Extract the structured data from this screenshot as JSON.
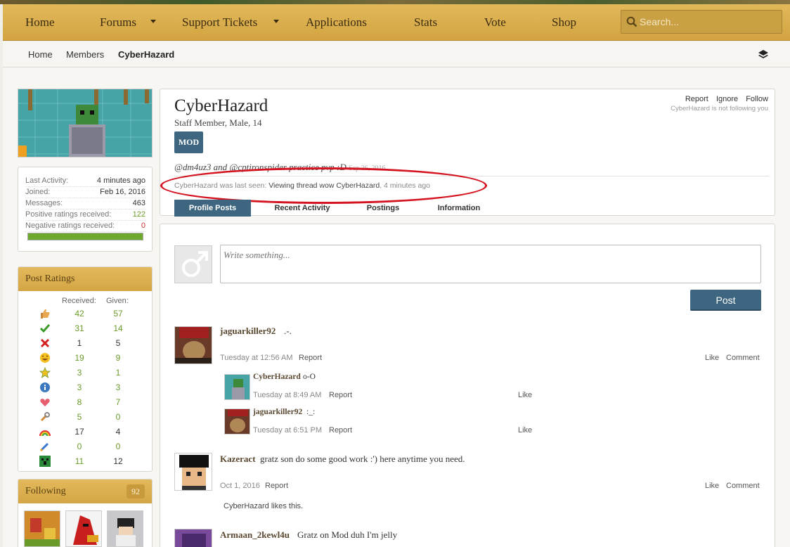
{
  "nav": {
    "items": [
      "Home",
      "Forums",
      "Support Tickets",
      "Applications",
      "Stats",
      "Vote",
      "Shop"
    ],
    "search_placeholder": "Search..."
  },
  "breadcrumb": [
    "Home",
    "Members",
    "CyberHazard"
  ],
  "sidebar": {
    "stats": [
      {
        "label": "Last Activity:",
        "value": "4 minutes ago"
      },
      {
        "label": "Joined:",
        "value": "Feb 16, 2016"
      },
      {
        "label": "Messages:",
        "value": "463"
      },
      {
        "label": "Positive ratings received:",
        "value": "122"
      },
      {
        "label": "Negative ratings received:",
        "value": "0"
      }
    ],
    "positive_ratio": 1.0,
    "post_ratings": {
      "title": "Post Ratings",
      "col_received": "Received:",
      "col_given": "Given:",
      "rows": [
        {
          "icon": "thumbs-up-icon",
          "received": "42",
          "given": "57"
        },
        {
          "icon": "checkmark-icon",
          "received": "31",
          "given": "14"
        },
        {
          "icon": "x-mark-icon",
          "received": "1",
          "given": "5"
        },
        {
          "icon": "laughing-face-icon",
          "received": "19",
          "given": "9"
        },
        {
          "icon": "star-icon",
          "received": "3",
          "given": "1"
        },
        {
          "icon": "info-icon",
          "received": "3",
          "given": "3"
        },
        {
          "icon": "heart-icon",
          "received": "8",
          "given": "7"
        },
        {
          "icon": "wrench-icon",
          "received": "5",
          "given": "0"
        },
        {
          "icon": "rainbow-icon",
          "received": "17",
          "given": "4"
        },
        {
          "icon": "paintbrush-icon",
          "received": "0",
          "given": "0"
        },
        {
          "icon": "creeper-icon",
          "received": "11",
          "given": "12"
        }
      ]
    },
    "following": {
      "title": "Following",
      "count": "92"
    }
  },
  "profile": {
    "name": "CyberHazard",
    "subtitle": "Staff Member, Male, 14",
    "badge": "MOD",
    "status": "@dm4uz3 and @cptironspider practice pvp :D",
    "status_date": "Sep 26, 2016",
    "last_seen_prefix": "CyberHazard was last seen:",
    "last_seen_action": "Viewing thread wow CyberHazard",
    "last_seen_time": ", 4 minutes ago",
    "actions": [
      "Report",
      "Ignore",
      "Follow"
    ],
    "not_following": "CyberHazard is not following you",
    "tabs": [
      "Profile Posts",
      "Recent Activity",
      "Postings",
      "Information"
    ]
  },
  "composer": {
    "placeholder": "Write something...",
    "button": "Post"
  },
  "posts": [
    {
      "author": "jaguarkiller92",
      "text": ".-.",
      "time": "Tuesday at 12:56 AM",
      "report": "Report",
      "like": "Like",
      "comment": "Comment",
      "replies": [
        {
          "author": "CyberHazard",
          "text": "o-O",
          "time": "Tuesday at 8:49 AM",
          "report": "Report",
          "like": "Like"
        },
        {
          "author": "jaguarkiller92",
          "text": ":_:",
          "time": "Tuesday at 6:51 PM",
          "report": "Report",
          "like": "Like"
        }
      ]
    },
    {
      "author": "Kazeract",
      "text": "gratz son do some good work :') here anytime you need.",
      "time": "Oct 1, 2016",
      "report": "Report",
      "like": "Like",
      "comment": "Comment",
      "likes": "CyberHazard likes this."
    },
    {
      "author": "Armaan_2kewl4u",
      "text": "Gratz on Mod duh I'm jelly"
    }
  ]
}
